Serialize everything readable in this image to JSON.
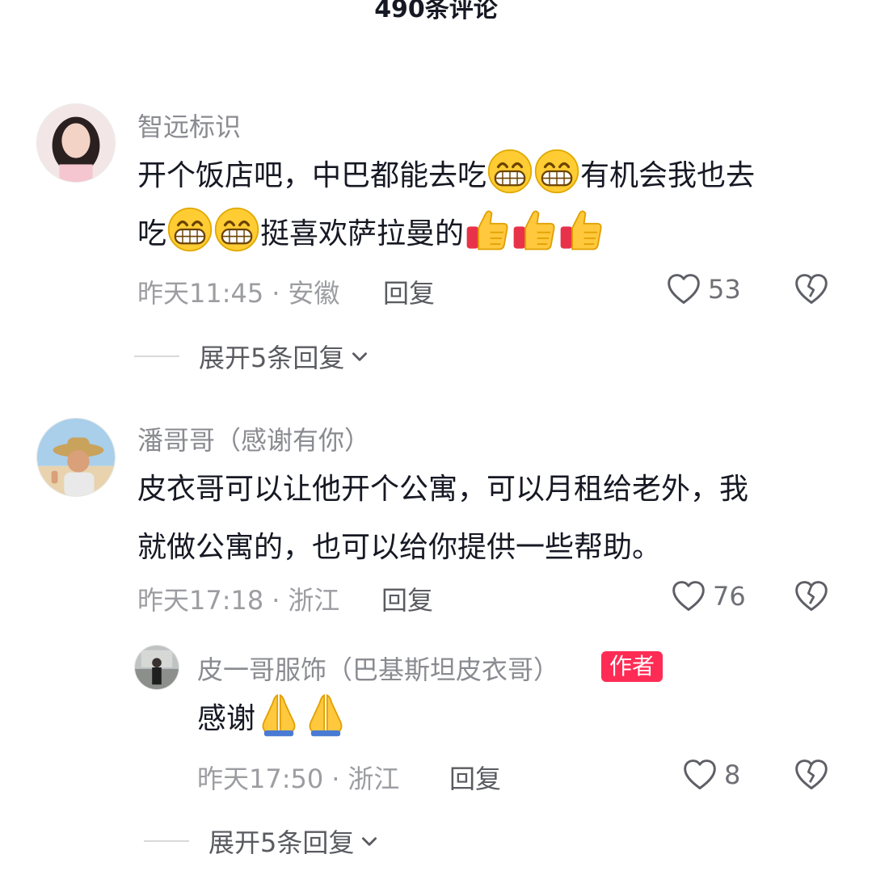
{
  "header": {
    "title": "490条评论"
  },
  "comments": [
    {
      "author": "智远标识",
      "text_parts": [
        "开个饭店吧，中巴都能去吃",
        "有机会我也去",
        "吃",
        "挺喜欢萨拉曼的"
      ],
      "time": "昨天11:45",
      "location": "安徽",
      "reply_label": "回复",
      "likes": "53",
      "expand_label": "展开5条回复"
    },
    {
      "author": "潘哥哥（感谢有你）",
      "text_line1": "皮衣哥可以让他开个公寓，可以月租给老外，我",
      "text_line2": "就做公寓的，也可以给你提供一些帮助。",
      "time": "昨天17:18",
      "location": "浙江",
      "reply_label": "回复",
      "likes": "76"
    }
  ],
  "reply": {
    "author": "皮一哥服饰（巴基斯坦皮衣哥）",
    "badge": "作者",
    "text": "感谢",
    "time": "昨天17:50",
    "location": "浙江",
    "reply_label": "回复",
    "likes": "8",
    "expand_label": "展开5条回复"
  },
  "icons": {
    "like": "heart-outline-icon",
    "dislike": "broken-heart-icon",
    "expand": "chevron-down-icon",
    "emoji_grin": "grinning-face-emoji",
    "emoji_thumb": "thumbs-up-emoji",
    "emoji_pray": "folded-hands-emoji"
  },
  "colors": {
    "badge": "#fe2c55",
    "secondary_text": "#9c9da1"
  }
}
